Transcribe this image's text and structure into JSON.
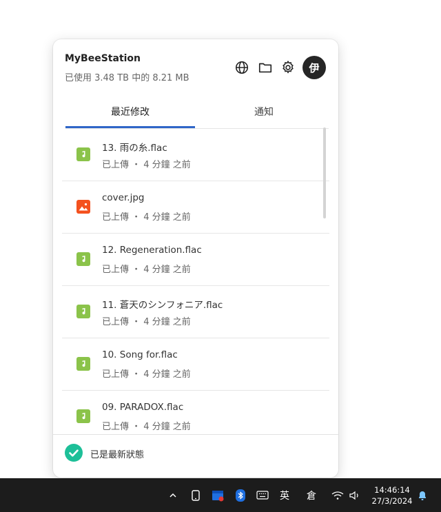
{
  "header": {
    "app_title": "MyBeeStation",
    "usage": "已使用 3.48 TB 中的 8.21 MB",
    "avatar_initial": "伊",
    "icons": [
      "globe-icon",
      "folder-icon",
      "gear-icon"
    ]
  },
  "tabs": [
    {
      "label": "最近修改",
      "active": true
    },
    {
      "label": "通知",
      "active": false
    }
  ],
  "files": [
    {
      "name": "13. 雨の糸.flac",
      "status": "已上傳 ・ 4 分鐘 之前",
      "type": "audio"
    },
    {
      "name": "cover.jpg",
      "status": "已上傳 ・ 4 分鐘 之前",
      "type": "image"
    },
    {
      "name": "12. Regeneration.flac",
      "status": "已上傳 ・ 4 分鐘 之前",
      "type": "audio"
    },
    {
      "name": "11. 蒼天のシンフォニア.flac",
      "status": "已上傳 ・ 4 分鐘 之前",
      "type": "audio"
    },
    {
      "name": "10. Song for.flac",
      "status": "已上傳 ・ 4 分鐘 之前",
      "type": "audio"
    },
    {
      "name": "09. PARADOX.flac",
      "status": "已上傳 ・ 4 分鐘 之前",
      "type": "audio"
    }
  ],
  "footer": {
    "status": "已是最新狀態"
  },
  "colors": {
    "accent": "#2f66c8",
    "audio_icon": "#8bc34a",
    "image_icon": "#f4511e",
    "status_ok": "#1dbf98"
  },
  "taskbar": {
    "ime_label": "英",
    "ime2_label": "倉",
    "time": "14:46:14",
    "date": "27/3/2024"
  }
}
